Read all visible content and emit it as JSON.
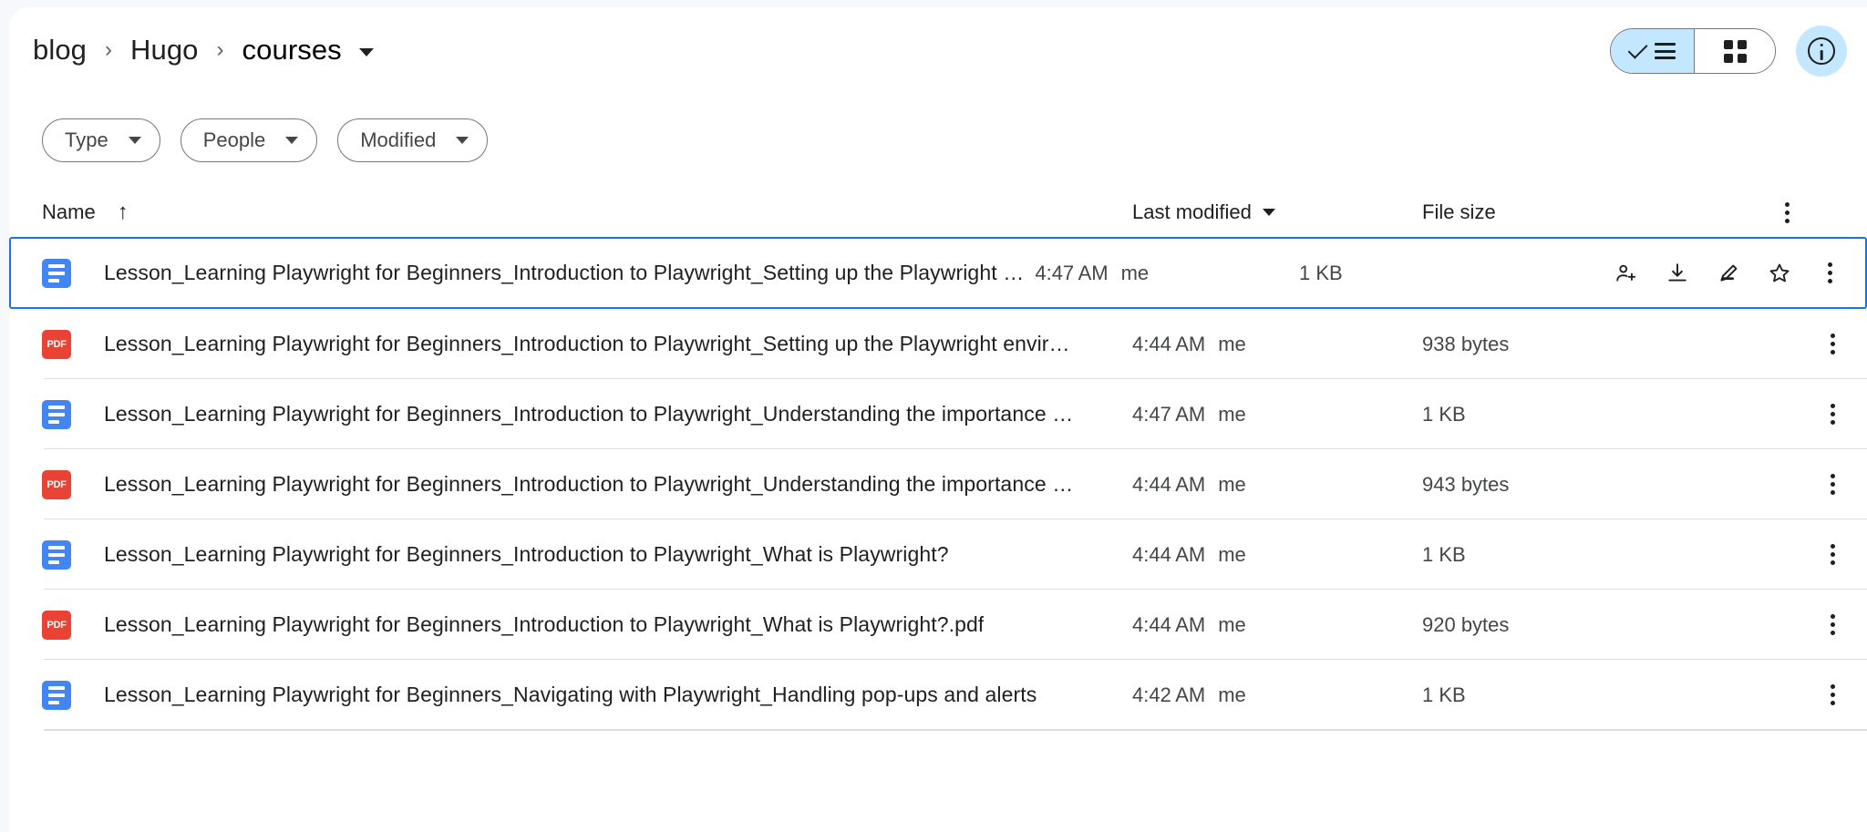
{
  "breadcrumb": {
    "items": [
      "blog",
      "Hugo",
      "courses"
    ],
    "separator": "›",
    "has_dropdown_caret": true
  },
  "header_controls": {
    "view_toggle": {
      "list_view_label": "List view",
      "grid_view_label": "Grid view",
      "active": "list"
    },
    "info_button_label": "View details",
    "accent_color": "#c2e7ff"
  },
  "filters": [
    {
      "label": "Type"
    },
    {
      "label": "People"
    },
    {
      "label": "Modified"
    }
  ],
  "columns": {
    "name": "Name",
    "name_sort_arrow": "↑",
    "last_modified": "Last modified",
    "file_size": "File size",
    "menu_label": "More options"
  },
  "row_actions": [
    {
      "name": "share-icon",
      "label": "Share"
    },
    {
      "name": "download-icon",
      "label": "Download"
    },
    {
      "name": "edit-icon",
      "label": "Edit"
    },
    {
      "name": "star-icon",
      "label": "Add to starred"
    },
    {
      "name": "more-icon",
      "label": "More actions"
    }
  ],
  "files": [
    {
      "name": "Lesson_Learning Playwright for Beginners_Introduction to Playwright_Setting up the Playwright envir…",
      "type": "doc",
      "modified_time": "4:47 AM",
      "modified_by": "me",
      "size": "1 KB",
      "selected": true
    },
    {
      "name": "Lesson_Learning Playwright for Beginners_Introduction to Playwright_Setting up the Playwright envir…",
      "type": "pdf",
      "modified_time": "4:44 AM",
      "modified_by": "me",
      "size": "938 bytes",
      "selected": false
    },
    {
      "name": "Lesson_Learning Playwright for Beginners_Introduction to Playwright_Understanding the importance …",
      "type": "doc",
      "modified_time": "4:47 AM",
      "modified_by": "me",
      "size": "1 KB",
      "selected": false
    },
    {
      "name": "Lesson_Learning Playwright for Beginners_Introduction to Playwright_Understanding the importance …",
      "type": "pdf",
      "modified_time": "4:44 AM",
      "modified_by": "me",
      "size": "943 bytes",
      "selected": false
    },
    {
      "name": "Lesson_Learning Playwright for Beginners_Introduction to Playwright_What is Playwright?",
      "type": "doc",
      "modified_time": "4:44 AM",
      "modified_by": "me",
      "size": "1 KB",
      "selected": false
    },
    {
      "name": "Lesson_Learning Playwright for Beginners_Introduction to Playwright_What is Playwright?.pdf",
      "type": "pdf",
      "modified_time": "4:44 AM",
      "modified_by": "me",
      "size": "920 bytes",
      "selected": false
    },
    {
      "name": "Lesson_Learning Playwright for Beginners_Navigating with Playwright_Handling pop-ups and alerts",
      "type": "doc",
      "modified_time": "4:42 AM",
      "modified_by": "me",
      "size": "1 KB",
      "selected": false
    }
  ],
  "icon_labels": {
    "doc": "google-docs-icon",
    "pdf": "pdf-file-icon",
    "pdf_text": "PDF"
  }
}
